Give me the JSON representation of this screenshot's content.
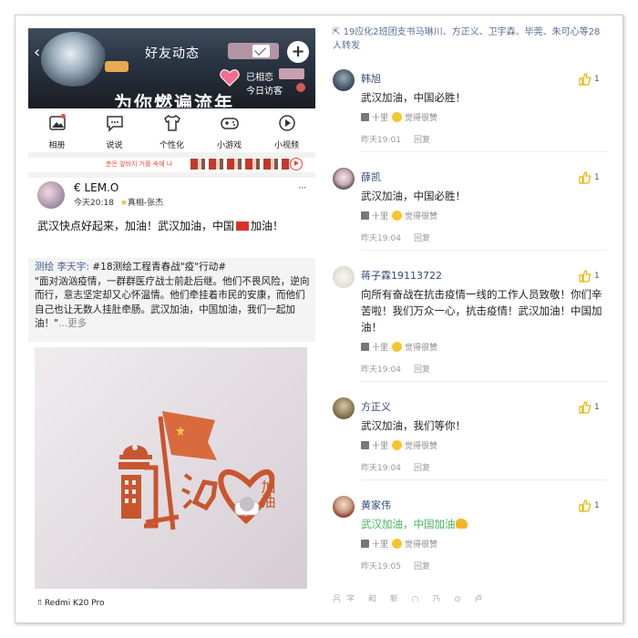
{
  "left": {
    "header": {
      "back_icon": "chevron-left-icon",
      "title": "好友动态",
      "message_icon": "envelope-icon",
      "plus_icon": "plus-icon",
      "status_label": "已相恋",
      "visitors_label": "今日访客",
      "big_text": "为你燃遍流年"
    },
    "nav": [
      {
        "label": "相册",
        "icon": "photo-icon"
      },
      {
        "label": "说说",
        "icon": "chat-icon"
      },
      {
        "label": "个性化",
        "icon": "shirt-icon"
      },
      {
        "label": "小游戏",
        "icon": "gamepad-icon"
      },
      {
        "label": "小视频",
        "icon": "play-circle-icon"
      }
    ],
    "strip": {
      "text": "춘은 앞바지 거를 속에 나",
      "play_icon": "play-circle-icon"
    },
    "post": {
      "username": "€  LEM.O",
      "time": "今天20:18",
      "tag": "真相-张杰",
      "more": "···",
      "text1": "武汉快点好起来，加油！武汉加油，中国",
      "text2": "加油！",
      "share_author": "测绘 李天宇:",
      "share_topic": " #18测绘工程青春战\"疫\"行动#",
      "share_body": "\"面对汹汹疫情，一群群医疗战士前赴后继。他们不畏风险，逆向而行，意志坚定却又心怀温情。他们牵挂着市民的安康，而他们自己也让无数人挂肚牵肠。武汉加油，中国加油，我们一起加油！\"",
      "share_more": "...更多",
      "poster_text_main": "武汉",
      "poster_text_side": "加油",
      "device": "Redmi K20 Pro"
    }
  },
  "right": {
    "forward_text": "19应化2班团支书马琳川、方正义、卫宇森、毕莞、朱可心等28人转发",
    "like_phrase": "觉得很赞",
    "like_user": "十里",
    "reply_label": "回复",
    "comments": [
      {
        "name": "韩旭",
        "text": "武汉加油，中国必胜！",
        "likes": "1",
        "time": "昨天19:01"
      },
      {
        "name": "薛凯",
        "text": "武汉加油，中国必胜！",
        "likes": "1",
        "time": "昨天19:04"
      },
      {
        "name": "蒋子霖19113722",
        "text": "向所有奋战在抗击疫情一线的工作人员致敬！你们辛苦啦！我们万众一心，抗击疫情！武汉加油！中国加油！",
        "likes": "1",
        "time": "昨天19:04"
      },
      {
        "name": "方正义",
        "text": "武汉加油，我们等你！",
        "likes": "1",
        "time": "昨天19:04"
      },
      {
        "name": "黄家伟",
        "text": "武汉加油，中国加油",
        "likes": "1",
        "time": "昨天19:05"
      }
    ],
    "partial_text": "吕字 和 新 ○ 乃 ⊙ 卢"
  },
  "colors": {
    "accent_red": "#d8312a",
    "link_blue": "#344a76",
    "like_yellow": "#f5c532"
  }
}
